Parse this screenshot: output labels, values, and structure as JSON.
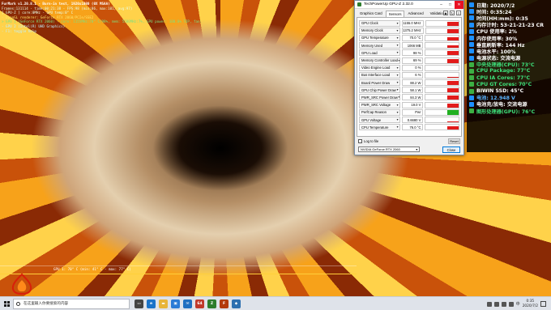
{
  "furmark": {
    "hud_lines": [
      "FurMark v1.20.8.1 - Burn-in test, 1920x1080 (0X MSAA)",
      "Frames:131114 - time:00:21:38 - FPS:98 (min:86, max:101, avg:97)",
      "[ GPU-Z ] core:0MHz - GPU temp:0° C",
      "- OpenGL renderer: GeForce RTX 2060/PCIe/SSE2",
      "> GPU 1 (GeForce RTX 2060) - core: 1155MHz:70° C/98%, mem: 5500MHz:7%, GPU power: 100.0% TDP, fan: 0%, limits:[power:1, temp:0, volt:0, OV:0]",
      "- GPU 2 (Intel(R) UHD Graphics)",
      "- F1: toggle help"
    ],
    "temp_graph_label": "GPU 1: 70° C (min: 41° C - max: 77° C)"
  },
  "gpuz": {
    "title": "TechPowerUp GPU-Z 2.32.0",
    "tabs": [
      "Graphics Card",
      "Sensors",
      "Advanced",
      "Validation"
    ],
    "active_tab": "Sensors",
    "sensors": [
      {
        "name": "GPU Clock",
        "value": "1155.0 MHz",
        "fill": 0.85,
        "color": "#e21b1b"
      },
      {
        "name": "Memory Clock",
        "value": "1375.2 MHz",
        "fill": 0.85,
        "color": "#e21b1b"
      },
      {
        "name": "GPU Temperature",
        "value": "70.0 °C",
        "fill": 0.7,
        "color": "#e21b1b"
      },
      {
        "name": "Memory Used",
        "value": "1066 MB",
        "fill": 0.6,
        "color": "#e21b1b"
      },
      {
        "name": "GPU Load",
        "value": "98 %",
        "fill": 0.95,
        "color": "#e21b1b"
      },
      {
        "name": "Memory Controller Load",
        "value": "69 %",
        "fill": 0.7,
        "color": "#e21b1b"
      },
      {
        "name": "Video Engine Load",
        "value": "0 %",
        "fill": 0.0,
        "color": "#e21b1b"
      },
      {
        "name": "Bus Interface Load",
        "value": "6 %",
        "fill": 0.1,
        "color": "#e21b1b"
      },
      {
        "name": "Board Power Draw",
        "value": "88.2 W",
        "fill": 0.85,
        "color": "#e21b1b"
      },
      {
        "name": "GPU Chip Power Draw",
        "value": "58.1 W",
        "fill": 0.8,
        "color": "#e21b1b"
      },
      {
        "name": "PWR_SRC Power Draw",
        "value": "84.3 W",
        "fill": 0.85,
        "color": "#e21b1b"
      },
      {
        "name": "PWR_SRC Voltage",
        "value": "19.0 V",
        "fill": 0.85,
        "color": "#e21b1b"
      },
      {
        "name": "PerfCap Reason",
        "value": "Pwr",
        "fill": 0.95,
        "color": "#21b021"
      },
      {
        "name": "GPU Voltage",
        "value": "0.6680 V",
        "fill": 0.15,
        "color": "#e21b1b"
      },
      {
        "name": "CPU Temperature",
        "value": "76.0 °C",
        "fill": 0.75,
        "color": "#e21b1b"
      }
    ],
    "log_to_file_label": "Log to file",
    "reset_label": "Reset",
    "gpu_selected": "NVIDIA GeForce RTX 2060",
    "close_label": "Close"
  },
  "osd": {
    "rows": [
      {
        "icon_color": "#1e90ff",
        "text": "日期: 2020/7/2",
        "color": "#ffffff"
      },
      {
        "icon_color": "#1e90ff",
        "text": "时间: 0:35:24",
        "color": "#ffffff"
      },
      {
        "icon_color": "#1e90ff",
        "text": "时间(HH:mm): 0:35",
        "color": "#ffffff"
      },
      {
        "icon_color": "#1e90ff",
        "text": "内存计时: 53-21-21-23 CR",
        "color": "#ffffff"
      },
      {
        "icon_color": "#1e90ff",
        "text": "CPU 使用率: 2%",
        "color": "#ffffff"
      },
      {
        "icon_color": "#1e90ff",
        "text": "内存使用率: 30%",
        "color": "#ffffff"
      },
      {
        "icon_color": "#1e90ff",
        "text": "垂直刷新率: 144 Hz",
        "color": "#ffffff"
      },
      {
        "icon_color": "#1e90ff",
        "text": "电池水平: 100%",
        "color": "#ffffff"
      },
      {
        "icon_color": "#1e90ff",
        "text": "电源状态: 交流电源",
        "color": "#ffffff"
      },
      {
        "icon_color": "#3cb043",
        "text": "中央处理器(CPU): 73°C",
        "color": "#3ee07a"
      },
      {
        "icon_color": "#3cb043",
        "text": "CPU Package: 77°C",
        "color": "#3ee07a"
      },
      {
        "icon_color": "#3cb043",
        "text": "CPU IA Cores: 77°C",
        "color": "#3ee07a"
      },
      {
        "icon_color": "#3cb043",
        "text": "CPU GT Cores: 70°C",
        "color": "#3ee07a"
      },
      {
        "icon_color": "#3cb043",
        "text": "BIWIN SSD: 45°C",
        "color": "#ffffff"
      },
      {
        "icon_color": "#1e90ff",
        "text": "电池: 12.948 V",
        "color": "#5ab4ff"
      },
      {
        "icon_color": "#1e90ff",
        "text": "电池充/放电: 交流电源",
        "color": "#ffffff"
      },
      {
        "icon_color": "#3cb043",
        "text": "图形处理器(GPU): 76°C",
        "color": "#3ee07a"
      }
    ]
  },
  "taskbar": {
    "search_placeholder": "在这里输入你要搜索的内容",
    "apps": [
      {
        "name": "task-view",
        "color": "#444444",
        "glyph": "▭"
      },
      {
        "name": "edge",
        "color": "#1a73c9",
        "glyph": "e"
      },
      {
        "name": "file-explorer",
        "color": "#e8b53a",
        "glyph": "▬"
      },
      {
        "name": "store",
        "color": "#2b7bd6",
        "glyph": "▣"
      },
      {
        "name": "mail",
        "color": "#1f6fc1",
        "glyph": "✉"
      },
      {
        "name": "aida64",
        "color": "#c0392b",
        "glyph": "64"
      },
      {
        "name": "gpuz",
        "color": "#2d7d2d",
        "glyph": "Z"
      },
      {
        "name": "furmark",
        "color": "#b33a0c",
        "glyph": "F"
      },
      {
        "name": "app-blue",
        "color": "#2c6fb0",
        "glyph": "◆"
      }
    ],
    "lang": "中",
    "time": "0:35",
    "date": "2020/7/2"
  }
}
